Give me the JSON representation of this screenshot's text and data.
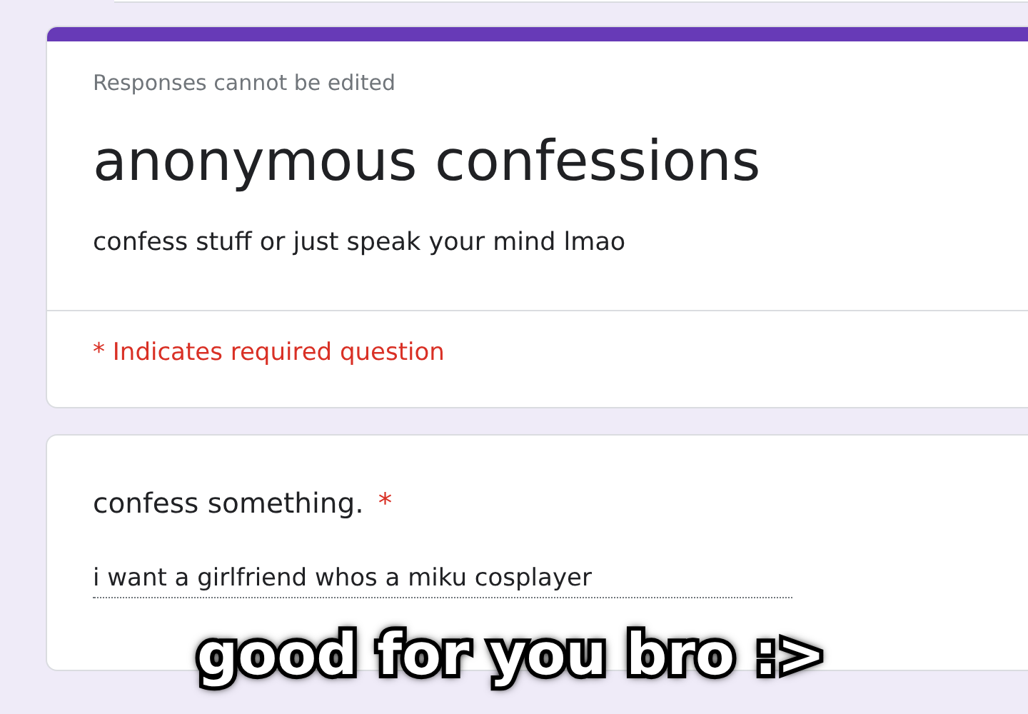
{
  "header": {
    "notice": "Responses cannot be edited",
    "title": "anonymous confessions",
    "description": "confess stuff or just speak your mind lmao",
    "required_note": "* Indicates required question"
  },
  "question": {
    "label": "confess something.",
    "required_mark": "*",
    "answer": "i want a girlfriend whos a miku cosplayer"
  },
  "caption": "good for you bro :>"
}
